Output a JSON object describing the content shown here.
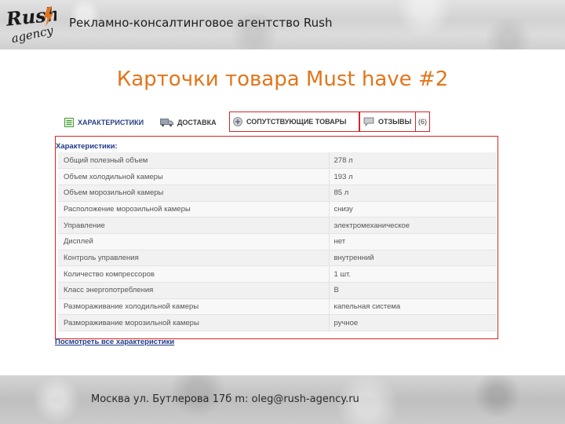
{
  "header": {
    "logo_text_1": "Rush",
    "logo_text_2": "agency",
    "title": "Рекламно-консалтинговое агентство Rush"
  },
  "slide": {
    "title": "Карточки товара Must have #2"
  },
  "tabs": [
    {
      "label": "ХАРАКТЕРИСТИКИ",
      "icon": "list-icon"
    },
    {
      "label": "ДОСТАВКА",
      "icon": "truck-icon"
    },
    {
      "label": "СОПУТСТВУЮЩИЕ ТОВАРЫ",
      "icon": "plus-circle-icon"
    },
    {
      "label": "ОТЗЫВЫ",
      "icon": "comment-icon"
    }
  ],
  "reviews_count": "(6)",
  "panel": {
    "title": "Характеристики:",
    "rows": [
      {
        "key": "Общий полезный объем",
        "value": "278 л"
      },
      {
        "key": "Объем холодильной камеры",
        "value": "193 л"
      },
      {
        "key": "Объем морозильной камеры",
        "value": "85 л"
      },
      {
        "key": "Расположение морозильной камеры",
        "value": "снизу"
      },
      {
        "key": "Управление",
        "value": "электромеханическое"
      },
      {
        "key": "Дисплей",
        "value": "нет"
      },
      {
        "key": "Контроль управления",
        "value": "внутренний"
      },
      {
        "key": "Количество компрессоров",
        "value": "1 шт."
      },
      {
        "key": "Класс энергопотребления",
        "value": "B"
      },
      {
        "key": "Размораживание холодильной камеры",
        "value": "капельная система"
      },
      {
        "key": "Размораживание морозильной камеры",
        "value": "ручное"
      }
    ],
    "view_all": "Посмотреть все характеристики"
  },
  "footer": {
    "address": "Москва ул. Бутлерова 17б m: oleg@rush-agency.ru"
  },
  "colors": {
    "accent_orange": "#e3751a",
    "highlight_red": "#d52626",
    "link_blue": "#1f3a8a"
  }
}
